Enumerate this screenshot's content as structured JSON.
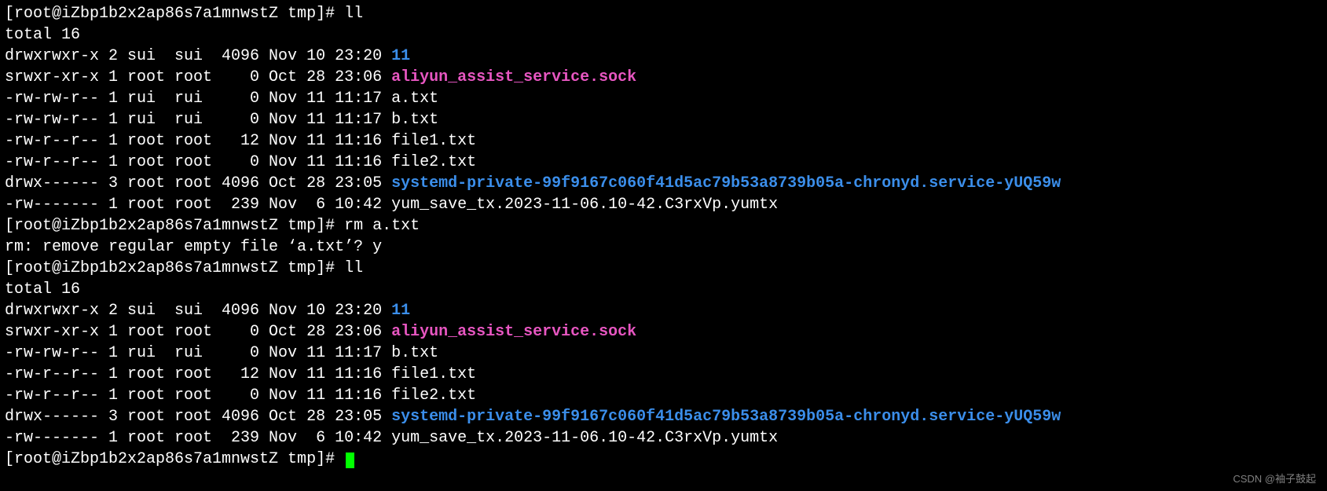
{
  "prompt": {
    "user": "root",
    "host": "iZbp1b2x2ap86s7a1mnwstZ",
    "cwd": "tmp",
    "symbol": "#"
  },
  "blocks": [
    {
      "cmd": "ll",
      "total": "total 16",
      "entries": [
        {
          "perm": "drwxrwxr-x",
          "links": "2",
          "owner": "sui ",
          "group": "sui ",
          "size": "4096",
          "date": "Nov 10 23:20",
          "name": "11",
          "cls": "dir"
        },
        {
          "perm": "srwxr-xr-x",
          "links": "1",
          "owner": "root",
          "group": "root",
          "size": "   0",
          "date": "Oct 28 23:06",
          "name": "aliyun_assist_service.sock",
          "cls": "sock"
        },
        {
          "perm": "-rw-rw-r--",
          "links": "1",
          "owner": "rui ",
          "group": "rui ",
          "size": "   0",
          "date": "Nov 11 11:17",
          "name": "a.txt",
          "cls": ""
        },
        {
          "perm": "-rw-rw-r--",
          "links": "1",
          "owner": "rui ",
          "group": "rui ",
          "size": "   0",
          "date": "Nov 11 11:17",
          "name": "b.txt",
          "cls": ""
        },
        {
          "perm": "-rw-r--r--",
          "links": "1",
          "owner": "root",
          "group": "root",
          "size": "  12",
          "date": "Nov 11 11:16",
          "name": "file1.txt",
          "cls": ""
        },
        {
          "perm": "-rw-r--r--",
          "links": "1",
          "owner": "root",
          "group": "root",
          "size": "   0",
          "date": "Nov 11 11:16",
          "name": "file2.txt",
          "cls": ""
        },
        {
          "perm": "drwx------",
          "links": "3",
          "owner": "root",
          "group": "root",
          "size": "4096",
          "date": "Oct 28 23:05",
          "name": "systemd-private-99f9167c060f41d5ac79b53a8739b05a-chronyd.service-yUQ59w",
          "cls": "dir"
        },
        {
          "perm": "-rw-------",
          "links": "1",
          "owner": "root",
          "group": "root",
          "size": " 239",
          "date": "Nov  6 10:42",
          "name": "yum_save_tx.2023-11-06.10-42.C3rxVp.yumtx",
          "cls": ""
        }
      ]
    },
    {
      "cmd": "rm a.txt",
      "confirm": "rm: remove regular empty file ‘a.txt’? y"
    },
    {
      "cmd": "ll",
      "total": "total 16",
      "entries": [
        {
          "perm": "drwxrwxr-x",
          "links": "2",
          "owner": "sui ",
          "group": "sui ",
          "size": "4096",
          "date": "Nov 10 23:20",
          "name": "11",
          "cls": "dir"
        },
        {
          "perm": "srwxr-xr-x",
          "links": "1",
          "owner": "root",
          "group": "root",
          "size": "   0",
          "date": "Oct 28 23:06",
          "name": "aliyun_assist_service.sock",
          "cls": "sock"
        },
        {
          "perm": "-rw-rw-r--",
          "links": "1",
          "owner": "rui ",
          "group": "rui ",
          "size": "   0",
          "date": "Nov 11 11:17",
          "name": "b.txt",
          "cls": ""
        },
        {
          "perm": "-rw-r--r--",
          "links": "1",
          "owner": "root",
          "group": "root",
          "size": "  12",
          "date": "Nov 11 11:16",
          "name": "file1.txt",
          "cls": ""
        },
        {
          "perm": "-rw-r--r--",
          "links": "1",
          "owner": "root",
          "group": "root",
          "size": "   0",
          "date": "Nov 11 11:16",
          "name": "file2.txt",
          "cls": ""
        },
        {
          "perm": "drwx------",
          "links": "3",
          "owner": "root",
          "group": "root",
          "size": "4096",
          "date": "Oct 28 23:05",
          "name": "systemd-private-99f9167c060f41d5ac79b53a8739b05a-chronyd.service-yUQ59w",
          "cls": "dir"
        },
        {
          "perm": "-rw-------",
          "links": "1",
          "owner": "root",
          "group": "root",
          "size": " 239",
          "date": "Nov  6 10:42",
          "name": "yum_save_tx.2023-11-06.10-42.C3rxVp.yumtx",
          "cls": ""
        }
      ]
    }
  ],
  "watermark": "CSDN @袖子鼓起"
}
